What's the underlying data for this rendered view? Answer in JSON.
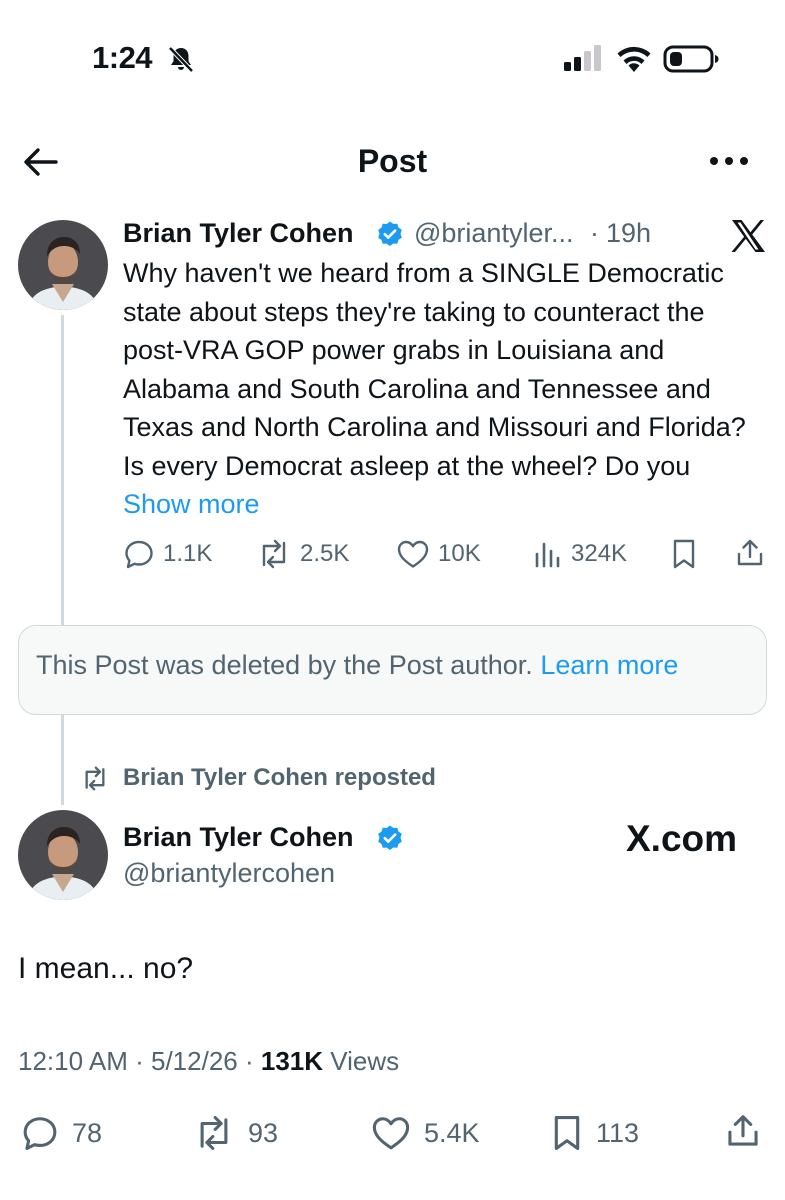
{
  "status_bar": {
    "time": "1:24"
  },
  "header": {
    "title": "Post"
  },
  "quoted_tweet": {
    "author_name": "Brian Tyler Cohen",
    "handle": "@briantyler...",
    "separator": "·",
    "time": "19h",
    "x_logo": "X",
    "body": "Why haven't we heard from a SINGLE Democratic state about steps they're taking to counteract the post-VRA GOP power grabs in Louisiana and Alabama and South Carolina and Tennessee and Texas and North Carolina and Missouri and Florida? Is every Democrat asleep at the wheel? Do you",
    "show_more": "Show more",
    "stats": {
      "replies": "1.1K",
      "reposts": "2.5K",
      "likes": "10K",
      "views": "324K"
    }
  },
  "deleted_notice": {
    "text": "This Post was deleted by the Post author.",
    "link": "Learn more"
  },
  "repost_label": "Brian Tyler Cohen reposted",
  "main_post": {
    "author_name": "Brian Tyler Cohen",
    "handle": "@briantylercohen",
    "watermark": "X.com",
    "text": "I mean... no?",
    "time": "12:10 AM",
    "sep1": "·",
    "date": "5/12/26",
    "sep2": "·",
    "views_count": "131K",
    "views_label": "Views",
    "stats": {
      "replies": "78",
      "reposts": "93",
      "likes": "5.4K",
      "bookmarks": "113"
    }
  },
  "colors": {
    "accent": "#1d9bf0",
    "secondary_text": "#536471",
    "border": "#cfd9de"
  },
  "icons": [
    "bell-slash-icon",
    "signal-icon",
    "wifi-icon",
    "battery-icon",
    "back-arrow-icon",
    "more-icon",
    "verified-badge-icon",
    "x-logo-icon",
    "reply-icon",
    "repost-icon",
    "like-icon",
    "views-icon",
    "bookmark-icon",
    "share-icon"
  ]
}
